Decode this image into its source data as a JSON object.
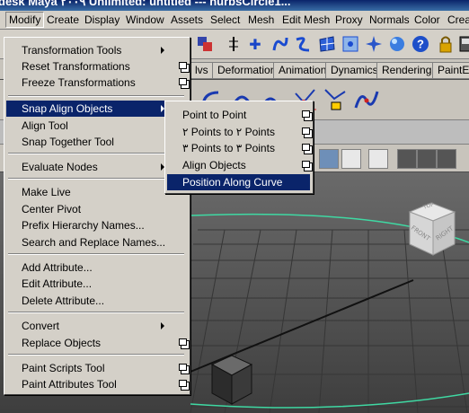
{
  "window": {
    "title": "desk Maya ۲۰۰۹ Unlimited: untitled  ---  nurbsCircle1..."
  },
  "menubar": {
    "items": [
      "Modify",
      "Create",
      "Display",
      "Window",
      "Assets",
      "Select",
      "Mesh",
      "Edit Mesh",
      "Proxy",
      "Normals",
      "Color",
      "Creat"
    ],
    "active": "Modify"
  },
  "shelf_tabs": [
    "lvs",
    "Deformation",
    "Animation",
    "Dynamics",
    "Rendering",
    "PaintEff"
  ],
  "modify_menu": {
    "items": [
      {
        "label": "Transformation Tools",
        "submenu": true
      },
      {
        "label": "Reset Transformations",
        "option": true
      },
      {
        "label": "Freeze Transformations",
        "option": true
      },
      {
        "label": "Snap Align Objects",
        "submenu": true,
        "highlighted": true
      },
      {
        "label": "Align Tool"
      },
      {
        "label": "Snap Together Tool"
      },
      {
        "label": "Evaluate Nodes",
        "submenu": true
      },
      {
        "label": "Make Live"
      },
      {
        "label": "Center Pivot"
      },
      {
        "label": "Prefix Hierarchy Names..."
      },
      {
        "label": "Search and Replace Names..."
      },
      {
        "label": "Add Attribute..."
      },
      {
        "label": "Edit Attribute..."
      },
      {
        "label": "Delete Attribute..."
      },
      {
        "label": "Convert",
        "submenu": true
      },
      {
        "label": "Replace Objects",
        "option": true
      },
      {
        "label": "Paint Scripts Tool",
        "option": true
      },
      {
        "label": "Paint Attributes Tool",
        "option": true
      }
    ]
  },
  "snap_submenu": {
    "items": [
      {
        "label": "Point to Point",
        "option": true
      },
      {
        "label": "۲ Points to ۲ Points",
        "option": true
      },
      {
        "label": "۳ Points to ۳ Points",
        "option": true
      },
      {
        "label": "Align Objects",
        "option": true
      },
      {
        "label": "Position Along Curve",
        "highlighted": true
      }
    ]
  },
  "viewcube": {
    "top": "TOP",
    "front": "FRONT",
    "right": "RIGHT"
  },
  "colors": {
    "highlight": "#0a246a",
    "menu_bg": "#d4d0c8",
    "grid": "#3c3c3c",
    "curve": "#3fd9a3"
  }
}
